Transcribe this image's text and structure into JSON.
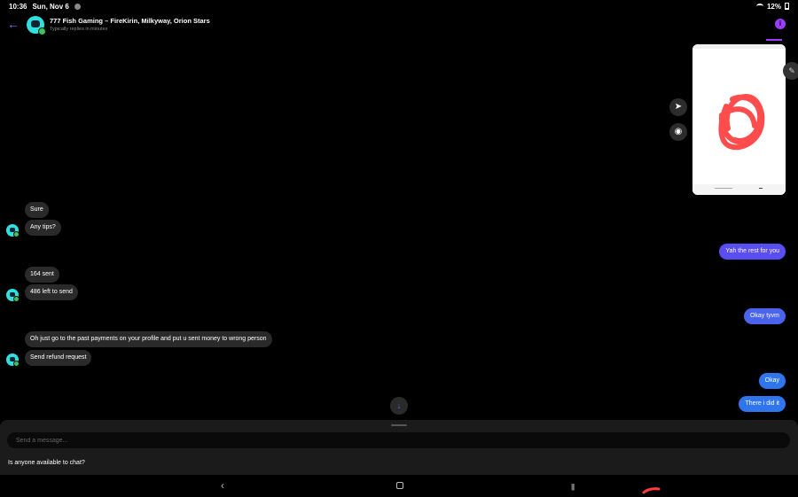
{
  "status": {
    "time": "10:36",
    "date": "Sun, Nov 6",
    "battery": "12%"
  },
  "header": {
    "title": "777 Fish Gaming – FireKirin, Milkyway, Orion Stars",
    "subtitle": "Typically replies in minutes"
  },
  "icons": {
    "back": "back-arrow-icon",
    "info": "info-icon",
    "share": "share-icon",
    "camera": "camera-icon",
    "edit": "pencil-icon",
    "scroll_down": "arrow-down-icon"
  },
  "messages": [
    {
      "from": "them",
      "text": "Sure"
    },
    {
      "from": "them",
      "text": "Any tips?"
    },
    {
      "from": "me",
      "text": "Yah the rest for you"
    },
    {
      "from": "them",
      "text": "164 sent"
    },
    {
      "from": "them",
      "text": "486 left to send"
    },
    {
      "from": "me",
      "text": "Okay tyvm"
    },
    {
      "from": "them",
      "text": "Oh just go to the past payments on your profile and put u sent money to wrong person"
    },
    {
      "from": "them",
      "text": "Send refund request"
    },
    {
      "from": "me",
      "text": "Okay"
    },
    {
      "from": "me",
      "text": "There i did it"
    }
  ],
  "composer": {
    "placeholder": "Send a message...",
    "suggestion": "Is anyone available to chat?"
  },
  "colors": {
    "accent": "#9b3cff",
    "bubble_incoming": "#2a2a2a",
    "bubble_outgoing_top": "#5a4df2",
    "bubble_outgoing_bottom": "#2f75ee",
    "online": "#3bc45b",
    "avatar": "#2fe0e0"
  }
}
